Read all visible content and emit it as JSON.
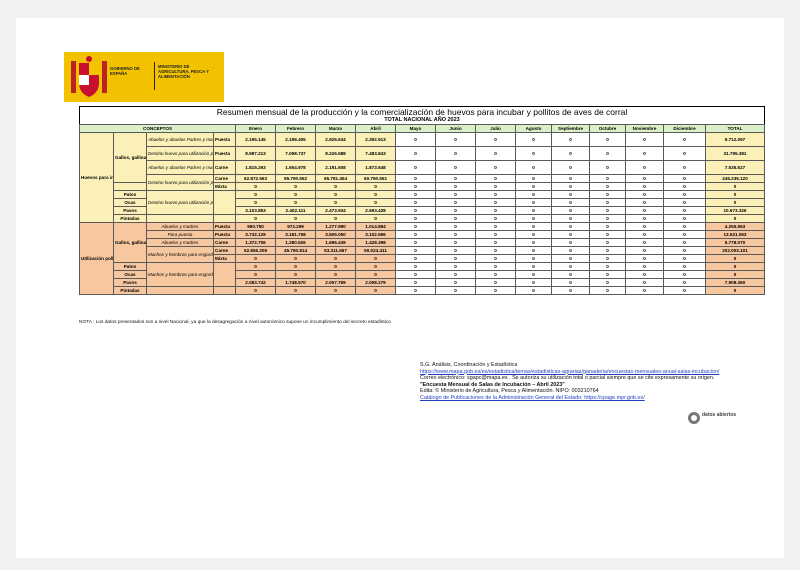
{
  "header": {
    "gov_text": "GOBIERNO DE ESPAÑA",
    "ministry_text": "MINISTERIO DE AGRICULTURA, PESCA Y ALIMENTACIÓN",
    "logo_color": "#f2c200"
  },
  "report": {
    "title": "Resumen mensual de la producción y la comercialización de huevos para incubar y pollitos de aves de corral",
    "subtitle": "TOTAL NACIONAL AÑO 2023"
  },
  "table": {
    "concepts_label": "CONCEPTOS",
    "months": [
      "Enero",
      "Febrero",
      "Marzo",
      "Abril",
      "Mayo",
      "Junio",
      "Julio",
      "Agosto",
      "Septiembre",
      "Octubre",
      "Noviembre",
      "Diciembre",
      "TOTAL"
    ],
    "groups": {
      "huevos": "Huevos para incubar puestos a incubar",
      "pollitos": "Utilización pollitos"
    },
    "species": {
      "gallinas_h": "Gallos, gallinas y pollos",
      "gallinas_p": "Gallos, gallinas y pollos",
      "patos": "Patos",
      "ocas": "Ocas",
      "pavos": "Pavos",
      "pintadas": "Pintadas"
    },
    "desc": {
      "abuelos_padres": "Abuelos y abuelas Padres y madres",
      "destino_util": "Destino huevo para utilización pollitos",
      "destino_util2": "Destino huevo para utilización pollitos",
      "abuelos_madres": "Abuelos y madres",
      "para_puesta": "Para puesta",
      "abuelos_y_madres": "Abuelos y madres",
      "machos_hembras": "Machos y hembras para engorde",
      "machos_hembras2": "Machos y hembras para engorde"
    },
    "types": {
      "puesta": "Puesta",
      "carne": "Carne",
      "mixta": "Mixta"
    },
    "rows": {
      "r1": [
        "2.195.145",
        "2.198.405",
        "2.925.634",
        "2.392.913",
        "0",
        "0",
        "0",
        "0",
        "0",
        "0",
        "0",
        "0",
        "9.712.097"
      ],
      "r2": [
        "8.987.213",
        "7.098.737",
        "8.226.588",
        "7.483.843",
        "0",
        "0",
        "0",
        "0",
        "0",
        "0",
        "0",
        "0",
        "31.795.381"
      ],
      "r3": [
        "1.815.293",
        "1.654.978",
        "2.191.608",
        "1.873.648",
        "0",
        "0",
        "0",
        "0",
        "0",
        "0",
        "0",
        "0",
        "7.535.527"
      ],
      "r4": [
        "62.872.563",
        "55.790.552",
        "65.781.454",
        "60.790.551",
        "0",
        "0",
        "0",
        "0",
        "0",
        "0",
        "0",
        "0",
        "245.235.120"
      ],
      "r5": [
        "0",
        "0",
        "0",
        "0",
        "0",
        "0",
        "0",
        "0",
        "0",
        "0",
        "0",
        "0",
        "0"
      ],
      "r6": [
        "0",
        "0",
        "0",
        "0",
        "0",
        "0",
        "0",
        "0",
        "0",
        "0",
        "0",
        "0",
        "0"
      ],
      "r7": [
        "0",
        "0",
        "0",
        "0",
        "0",
        "0",
        "0",
        "0",
        "0",
        "0",
        "0",
        "0",
        "0"
      ],
      "r8": [
        "3.103.853",
        "2.402.111",
        "2.473.934",
        "2.693.428",
        "0",
        "0",
        "0",
        "0",
        "0",
        "0",
        "0",
        "0",
        "10.673.326"
      ],
      "r9": [
        "0",
        "0",
        "0",
        "0",
        "0",
        "0",
        "0",
        "0",
        "0",
        "0",
        "0",
        "0",
        "0"
      ],
      "p1": [
        "990.750",
        "972.299",
        "1.277.990",
        "1.014.894",
        "0",
        "0",
        "0",
        "0",
        "0",
        "0",
        "0",
        "0",
        "4.255.963"
      ],
      "p2": [
        "3.732.129",
        "3.181.768",
        "3.505.050",
        "3.102.596",
        "0",
        "0",
        "0",
        "0",
        "0",
        "0",
        "0",
        "0",
        "13.521.063"
      ],
      "p3": [
        "1.372.706",
        "1.280.526",
        "1.696.439",
        "1.428.398",
        "0",
        "0",
        "0",
        "0",
        "0",
        "0",
        "0",
        "0",
        "5.778.070"
      ],
      "p4": [
        "52.856.209",
        "45.790.814",
        "53.311.667",
        "50.024.411",
        "0",
        "0",
        "0",
        "0",
        "0",
        "0",
        "0",
        "0",
        "202.003.101"
      ],
      "p5": [
        "0",
        "0",
        "0",
        "0",
        "0",
        "0",
        "0",
        "0",
        "0",
        "0",
        "0",
        "0",
        "0"
      ],
      "p6": [
        "0",
        "0",
        "0",
        "0",
        "0",
        "0",
        "0",
        "0",
        "0",
        "0",
        "0",
        "0",
        "0"
      ],
      "p7": [
        "0",
        "0",
        "0",
        "0",
        "0",
        "0",
        "0",
        "0",
        "0",
        "0",
        "0",
        "0",
        "0"
      ],
      "p8": [
        "2.083.742",
        "1.748.570",
        "2.057.769",
        "2.008.279",
        "0",
        "0",
        "0",
        "0",
        "0",
        "0",
        "0",
        "0",
        "7.908.360"
      ],
      "p9": [
        "0",
        "0",
        "0",
        "0",
        "0",
        "0",
        "0",
        "0",
        "0",
        "0",
        "0",
        "0",
        "0"
      ]
    }
  },
  "note": "NOTA : Los datos presentados son a nivel Nacional, ya que la desagregación a nivel autonómico supone un incumplimiento del secreto estadístico",
  "credits": {
    "line1": "S.G. Análisis, Coordinación y Estadística",
    "url1": "https://www.mapa.gob.es/es/estadistica/temas/estadisticas-agrarias/ganaderia/encuestas-mensuales-anual-salas-incubacion/",
    "email": "Correo electrónico: sgapc@mapa.es . Se autoriza su utilización total o parcial siempre que se cite expresamente su origen.",
    "survey": "\"Encuesta Mensual de Salas de Incubación – Abril 2023\"",
    "edita": "Edita: © Ministerio de Agricultura, Pesca y Alimentación. NIPO: 003210764",
    "catalogo": "Catálogo de Publicaciones de la Administración General del Estado:  https://cpage.mpr.gob.es/"
  },
  "datos_abiertos": "datos abiertos",
  "colors": {
    "yellow": "#fbf0b8",
    "orange": "#f7c8a0",
    "green": "#d9f0c8"
  }
}
